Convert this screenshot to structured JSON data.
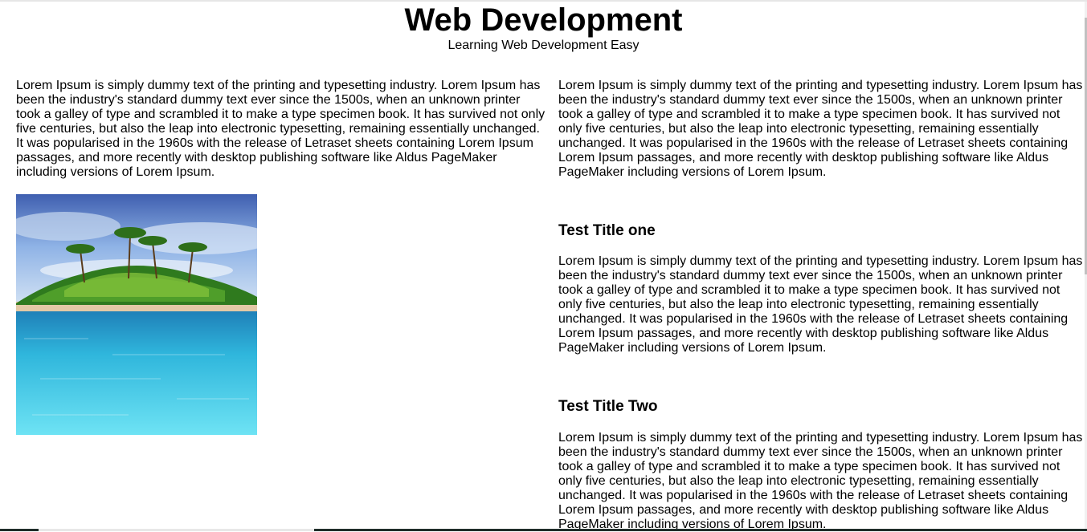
{
  "header": {
    "title": "Web Development",
    "subtitle": "Learning Web Development Easy"
  },
  "left": {
    "paragraph": "Lorem Ipsum is simply dummy text of the printing and typesetting industry. Lorem Ipsum has been the industry's standard dummy text ever since the 1500s, when an unknown printer took a galley of type and scrambled it to make a type specimen book. It has survived not only five centuries, but also the leap into electronic typesetting, remaining essentially unchanged. It was popularised in the 1960s with the release of Letraset sheets containing Lorem Ipsum passages, and more recently with desktop publishing software like Aldus PageMaker including versions of Lorem Ipsum.",
    "image": "tropical-island-photo"
  },
  "right": {
    "intro": "Lorem Ipsum is simply dummy text of the printing and typesetting industry. Lorem Ipsum has been the industry's standard dummy text ever since the 1500s, when an unknown printer took a galley of type and scrambled it to make a type specimen book. It has survived not only five centuries, but also the leap into electronic typesetting, remaining essentially unchanged. It was popularised in the 1960s with the release of Letraset sheets containing Lorem Ipsum passages, and more recently with desktop publishing software like Aldus PageMaker including versions of Lorem Ipsum.",
    "sections": [
      {
        "title": "Test Title one",
        "body": "Lorem Ipsum is simply dummy text of the printing and typesetting industry. Lorem Ipsum has been the industry's standard dummy text ever since the 1500s, when an unknown printer took a galley of type and scrambled it to make a type specimen book. It has survived not only five centuries, but also the leap into electronic typesetting, remaining essentially unchanged. It was popularised in the 1960s with the release of Letraset sheets containing Lorem Ipsum passages, and more recently with desktop publishing software like Aldus PageMaker including versions of Lorem Ipsum."
      },
      {
        "title": "Test Title Two",
        "body": "Lorem Ipsum is simply dummy text of the printing and typesetting industry. Lorem Ipsum has been the industry's standard dummy text ever since the 1500s, when an unknown printer took a galley of type and scrambled it to make a type specimen book. It has survived not only five centuries, but also the leap into electronic typesetting, remaining essentially unchanged. It was popularised in the 1960s with the release of Letraset sheets containing Lorem Ipsum passages, and more recently with desktop publishing software like Aldus PageMaker including versions of Lorem Ipsum."
      }
    ]
  }
}
